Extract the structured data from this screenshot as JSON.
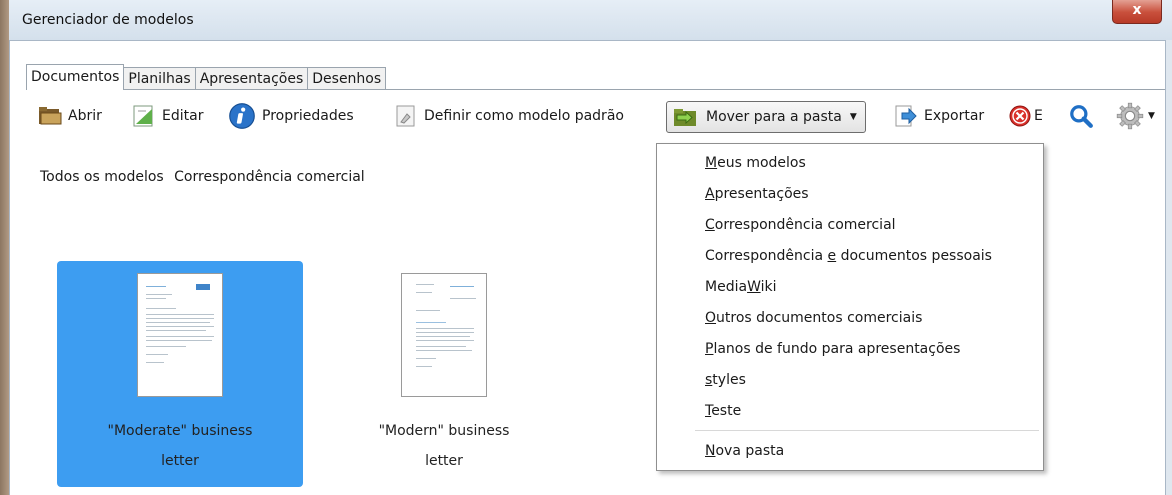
{
  "window": {
    "title": "Gerenciador de modelos",
    "close_glyph": "x"
  },
  "tabs": [
    {
      "label": "Documentos",
      "active": true
    },
    {
      "label": "Planilhas",
      "active": false
    },
    {
      "label": "Apresentações",
      "active": false
    },
    {
      "label": "Desenhos",
      "active": false
    }
  ],
  "toolbar": {
    "open": {
      "label": "Abrir",
      "icon": "folder-open-icon"
    },
    "edit": {
      "label": "Editar",
      "icon": "edit-document-icon"
    },
    "properties": {
      "label": "Propriedades",
      "icon": "info-icon"
    },
    "set_default": {
      "label": "Definir como modelo padrão",
      "icon": "default-template-icon"
    },
    "move": {
      "label": "Mover para a pasta",
      "icon": "move-to-folder-icon"
    },
    "export": {
      "label": "Exportar",
      "icon": "export-icon"
    },
    "delete": {
      "label": "E",
      "icon": "delete-icon"
    },
    "search": {
      "icon": "search-icon"
    },
    "settings": {
      "icon": "gear-icon"
    }
  },
  "breadcrumb": [
    "Todos os modelos",
    "Correspondência comercial"
  ],
  "templates": [
    {
      "name_line1": "\"Moderate\" business",
      "name_line2": "letter",
      "selected": true
    },
    {
      "name_line1": "\"Modern\" business",
      "name_line2": "letter",
      "selected": false
    }
  ],
  "move_menu": {
    "items": [
      {
        "pre": "",
        "u": "M",
        "post": "eus modelos"
      },
      {
        "pre": "",
        "u": "A",
        "post": "presentações"
      },
      {
        "pre": "",
        "u": "C",
        "post": "orrespondência comercial"
      },
      {
        "pre": "Correspondência ",
        "u": "e",
        "post": " documentos pessoais"
      },
      {
        "pre": "Media",
        "u": "W",
        "post": "iki"
      },
      {
        "pre": "",
        "u": "O",
        "post": "utros documentos comerciais"
      },
      {
        "pre": "",
        "u": "P",
        "post": "lanos de fundo para apresentações"
      },
      {
        "pre": "",
        "u": "s",
        "post": "tyles"
      },
      {
        "pre": "",
        "u": "T",
        "post": "este"
      }
    ],
    "new_folder": {
      "pre": "",
      "u": "N",
      "post": "ova pasta"
    }
  },
  "colors": {
    "selection": "#3d9df1",
    "accent": "#1f6fc5",
    "delete_red": "#d9302a"
  }
}
